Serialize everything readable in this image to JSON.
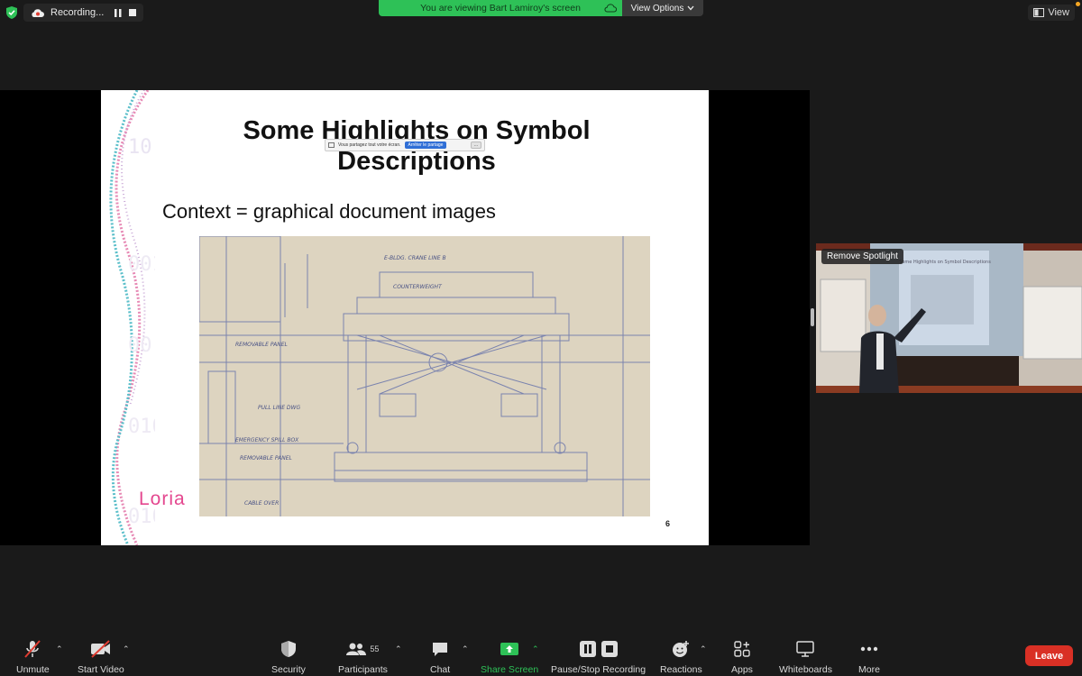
{
  "topbar": {
    "recording_label": "Recording...",
    "viewing_text": "You are viewing Bart Lamiroy's screen",
    "view_options_label": "View Options",
    "view_label": "View"
  },
  "slide": {
    "title": "Some Highlights on Symbol Descriptions",
    "subtitle": "Context = graphical document images",
    "logo": "Loria",
    "page_number": "6",
    "sharing_toast_text": "Vous partagez tout votre écran.",
    "sharing_toast_stop": "Arrêter le partage",
    "sharing_toast_more": "...",
    "blueprint_annotations": [
      "E-BLDG. CRANE LINE B",
      "REMOVABLE PANEL",
      "PULL LINE DWG",
      "EMERGENCY SPILL BOX",
      "REMOVABLE PANEL",
      "CABLE OVER",
      "COUNTERWEIGHT"
    ]
  },
  "speaker": {
    "spotlight_label": "Remove Spotlight",
    "slide_title": "Some Highlights on Symbol Descriptions"
  },
  "toolbar": {
    "unmute": "Unmute",
    "start_video": "Start Video",
    "security": "Security",
    "participants": "Participants",
    "participants_count": "55",
    "chat": "Chat",
    "share_screen": "Share Screen",
    "pause_recording": "Pause/Stop Recording",
    "reactions": "Reactions",
    "apps": "Apps",
    "whiteboards": "Whiteboards",
    "more": "More",
    "leave": "Leave"
  },
  "colors": {
    "accent_green": "#2ec157",
    "leave_red": "#d93025",
    "background": "#1a1a1a"
  }
}
